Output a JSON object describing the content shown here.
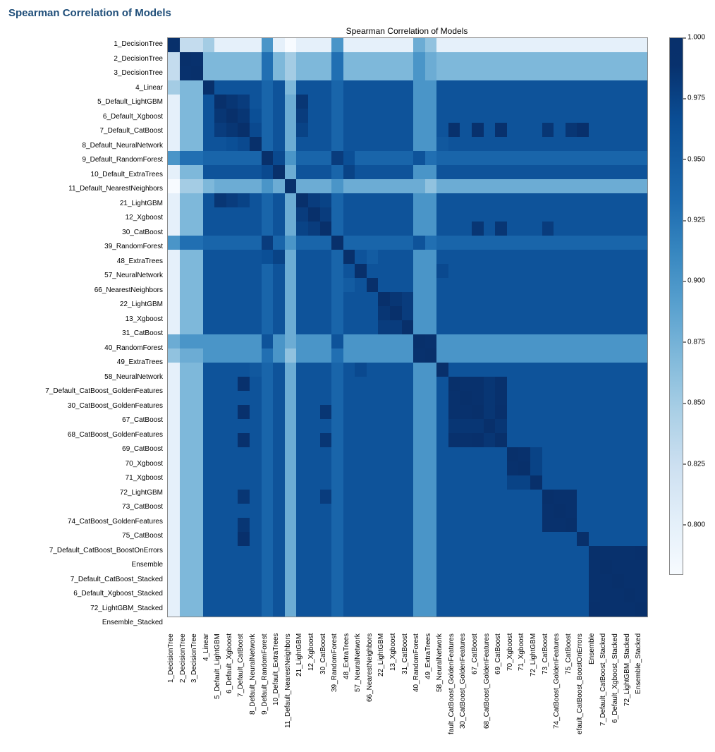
{
  "page_title": "Spearman Correlation of Models",
  "chart_data": {
    "type": "heatmap",
    "title": "Spearman Correlation of Models",
    "xlabel": "",
    "ylabel": "",
    "colorbar": {
      "min": 0.78,
      "max": 1.0,
      "ticks": [
        1.0,
        0.975,
        0.95,
        0.925,
        0.9,
        0.875,
        0.85,
        0.825,
        0.8
      ],
      "tick_labels": [
        "1.000",
        "0.975",
        "0.950",
        "0.925",
        "0.900",
        "0.875",
        "0.850",
        "0.825",
        "0.800"
      ]
    },
    "labels": [
      "1_DecisionTree",
      "2_DecisionTree",
      "3_DecisionTree",
      "4_Linear",
      "5_Default_LightGBM",
      "6_Default_Xgboost",
      "7_Default_CatBoost",
      "8_Default_NeuralNetwork",
      "9_Default_RandomForest",
      "10_Default_ExtraTrees",
      "11_Default_NearestNeighbors",
      "21_LightGBM",
      "12_Xgboost",
      "30_CatBoost",
      "39_RandomForest",
      "48_ExtraTrees",
      "57_NeuralNetwork",
      "66_NearestNeighbors",
      "22_LightGBM",
      "13_Xgboost",
      "31_CatBoost",
      "40_RandomForest",
      "49_ExtraTrees",
      "58_NeuralNetwork",
      "7_Default_CatBoost_GoldenFeatures",
      "30_CatBoost_GoldenFeatures",
      "67_CatBoost",
      "68_CatBoost_GoldenFeatures",
      "69_CatBoost",
      "70_Xgboost",
      "71_Xgboost",
      "72_LightGBM",
      "73_CatBoost",
      "74_CatBoost_GoldenFeatures",
      "75_CatBoost",
      "7_Default_CatBoost_BoostOnErrors",
      "Ensemble",
      "7_Default_CatBoost_Stacked",
      "6_Default_Xgboost_Stacked",
      "72_LightGBM_Stacked",
      "Ensemble_Stacked"
    ],
    "x_label_overrides": {
      "24": "fault_CatBoost_GoldenFeatures",
      "35": "efault_CatBoost_BoostOnErrors"
    },
    "base_default": 0.96,
    "base_overrides": {
      "0": 0.8,
      "1": 0.87,
      "2": 0.87,
      "8": 0.94,
      "10": 0.88,
      "14": 0.94,
      "21": 0.9,
      "22": 0.9
    },
    "pair_overrides": {
      "0-1": 0.83,
      "0-2": 0.83,
      "1-2": 0.99,
      "0-3": 0.85,
      "1-3": 0.87,
      "2-3": 0.87,
      "0-8": 0.9,
      "1-8": 0.93,
      "2-8": 0.93,
      "0-10": 0.78,
      "1-10": 0.85,
      "2-10": 0.85,
      "3-10": 0.87,
      "8-10": 0.9,
      "0-14": 0.9,
      "1-14": 0.93,
      "2-14": 0.93,
      "8-14": 0.98,
      "10-14": 0.9,
      "0-21": 0.88,
      "1-21": 0.9,
      "2-21": 0.9,
      "8-21": 0.96,
      "10-21": 0.88,
      "14-21": 0.96,
      "0-22": 0.86,
      "1-22": 0.88,
      "2-22": 0.88,
      "8-22": 0.93,
      "10-22": 0.86,
      "14-22": 0.93,
      "21-22": 0.99,
      "4-5": 0.985,
      "4-6": 0.98,
      "4-7": 0.96,
      "5-6": 0.985,
      "5-7": 0.965,
      "6-7": 0.97,
      "4-11": 0.985,
      "5-11": 0.98,
      "6-11": 0.975,
      "11-12": 0.98,
      "11-13": 0.975,
      "12-13": 0.98,
      "18-19": 0.985,
      "18-20": 0.98,
      "19-20": 0.98,
      "24-25": 0.99,
      "24-26": 0.99,
      "24-27": 0.985,
      "24-28": 0.99,
      "25-26": 0.99,
      "25-27": 0.985,
      "25-28": 0.99,
      "26-27": 0.985,
      "26-28": 0.995,
      "27-28": 0.985,
      "29-30": 0.99,
      "29-31": 0.975,
      "30-31": 0.975,
      "32-33": 0.99,
      "32-34": 0.99,
      "33-34": 0.99,
      "36-37": 0.99,
      "36-38": 0.99,
      "36-39": 0.99,
      "36-40": 0.995,
      "37-38": 0.99,
      "37-39": 0.99,
      "37-40": 0.99,
      "38-39": 0.99,
      "38-40": 0.99,
      "39-40": 0.99,
      "6-35": 0.995,
      "6-24": 0.99,
      "6-26": 0.99,
      "6-28": 0.99,
      "6-32": 0.985,
      "6-34": 0.985,
      "13-26": 0.985,
      "13-28": 0.985,
      "13-32": 0.98,
      "8-9": 0.97,
      "9-15": 0.975,
      "8-15": 0.965,
      "15-17": 0.95,
      "16-23": 0.97,
      "7-16": 0.96,
      "7-23": 0.955
    }
  }
}
